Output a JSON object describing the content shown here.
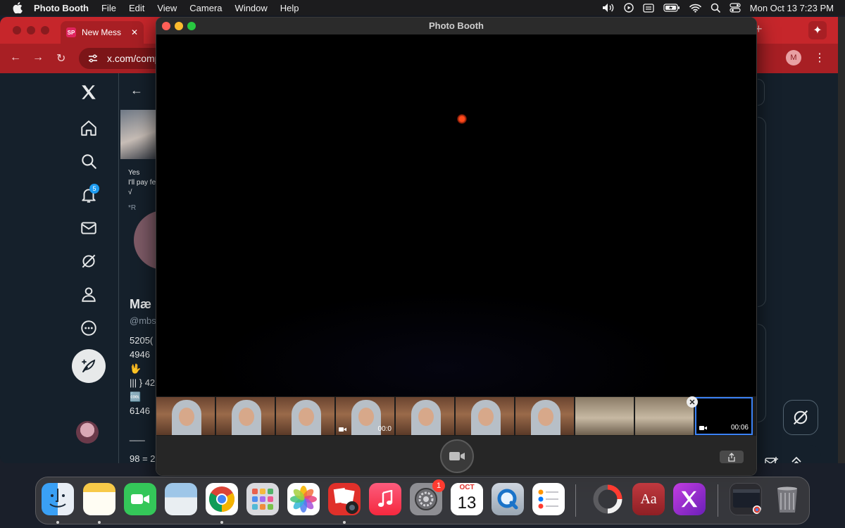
{
  "menubar": {
    "app_name": "Photo Booth",
    "menus": [
      "File",
      "Edit",
      "View",
      "Camera",
      "Window",
      "Help"
    ],
    "clock": "Mon Oct 13  7:23 PM"
  },
  "chrome": {
    "tab_favicon": "SP",
    "tab_title": "New Mess",
    "omnibox_url": "x.com/comp",
    "profile_initial": "M",
    "accent": "#c6262b"
  },
  "x": {
    "notifications_badge": "5",
    "post_lines": [
      "Yes",
      "I'll pay fe",
      "√",
      "*R"
    ],
    "profile_name": "Mæ",
    "profile_handle": "@mbs",
    "stats": [
      "5205(",
      "4946",
      "🖖",
      "||| } 42",
      "🆒",
      " 6146",
      "___",
      "98 = 2"
    ]
  },
  "photobooth": {
    "window_title": "Photo Booth",
    "thumbnails": [
      {
        "kind": "person",
        "duration": ""
      },
      {
        "kind": "person",
        "duration": ""
      },
      {
        "kind": "person",
        "duration": ""
      },
      {
        "kind": "person",
        "duration": "00:0"
      },
      {
        "kind": "person",
        "duration": ""
      },
      {
        "kind": "person",
        "duration": ""
      },
      {
        "kind": "person",
        "duration": ""
      },
      {
        "kind": "room",
        "duration": ""
      },
      {
        "kind": "room",
        "duration": ""
      },
      {
        "kind": "selected",
        "duration": "00:06"
      }
    ]
  },
  "dock": {
    "settings_badge": "1",
    "calendar_month": "OCT",
    "calendar_day": "13",
    "dictionary_label": "Aa"
  }
}
